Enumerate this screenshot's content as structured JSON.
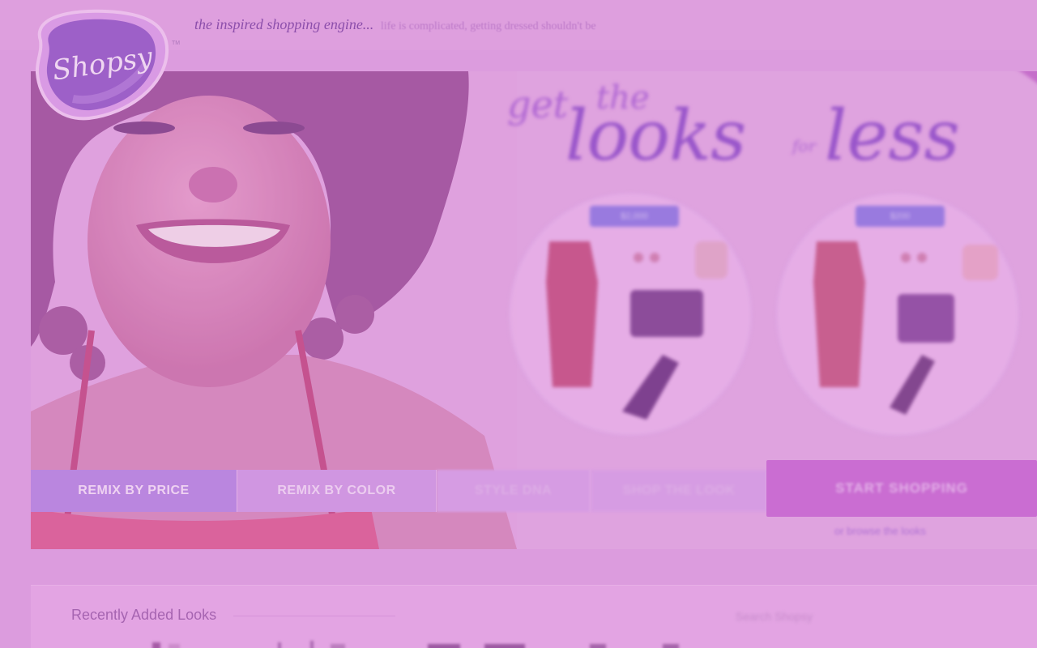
{
  "site": {
    "logo_text": "Shopsy",
    "trademark": "TM",
    "tagline": "the inspired shopping engine...",
    "tagline_sub": "life is complicated, getting dressed shouldn't be"
  },
  "hero": {
    "headline_get": "get",
    "headline_the": "the",
    "headline_looks": "looks",
    "headline_for": "for",
    "headline_less": "less",
    "price_tag_1": "$2,000",
    "price_tag_2": "$200"
  },
  "tabs": [
    {
      "label": "REMIX BY PRICE",
      "active": true
    },
    {
      "label": "REMIX BY COLOR",
      "active": false
    },
    {
      "label": "STYLE DNA",
      "active": false
    },
    {
      "label": "SHOP THE LOOK",
      "active": false
    }
  ],
  "cta": {
    "start_label": "START SHOPPING",
    "sub_link": "or browse the looks"
  },
  "recent": {
    "title": "Recently Added Looks",
    "right_heading": "Search Shopsy"
  },
  "colors": {
    "background": "#dc9ede",
    "accent_purple": "#8a48c6",
    "cta_magenta": "#c665d0",
    "active_tab": "#b283e0"
  }
}
